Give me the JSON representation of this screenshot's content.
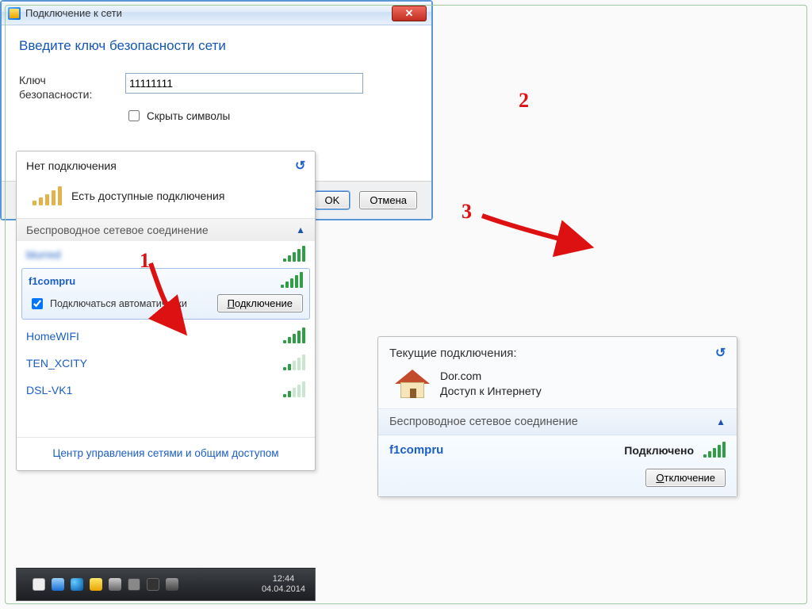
{
  "annotations": {
    "n1": "1",
    "n2": "2",
    "n3": "3"
  },
  "panel_nets": {
    "header_no_conn": "Нет подключения",
    "available_label": "Есть доступные подключения",
    "section_wireless": "Беспроводное сетевое соединение",
    "selected": {
      "name": "f1compru",
      "auto_connect_label": "Подключаться автоматически",
      "auto_connect_checked": true,
      "connect_btn_prefix": "П",
      "connect_btn_rest": "одключение"
    },
    "networks": [
      {
        "name": "HomeWIFI",
        "strength": "strong"
      },
      {
        "name": "TEN_XCITY",
        "strength": "weak"
      },
      {
        "name": "DSL-VK1",
        "strength": "weak"
      }
    ],
    "footer_link": "Центр управления сетями и общим доступом"
  },
  "panel_key": {
    "title": "Подключение к сети",
    "heading": "Введите ключ безопасности сети",
    "key_label": "Ключ безопасности:",
    "key_value": "11111111",
    "checkbox_label": "Скрыть символы",
    "checkbox_checked": false,
    "ok_btn": "OK",
    "cancel_btn": "Отмена"
  },
  "panel_cur": {
    "header": "Текущие подключения:",
    "network_name": "Dor.com",
    "network_status": "Доступ к Интернету",
    "section": "Беспроводное сетевое соединение",
    "item_name": "f1compru",
    "item_status": "Подключено",
    "disconnect_prefix": "О",
    "disconnect_rest": "тключение"
  },
  "taskbar": {
    "time": "12:44",
    "date": "04.04.2014"
  }
}
